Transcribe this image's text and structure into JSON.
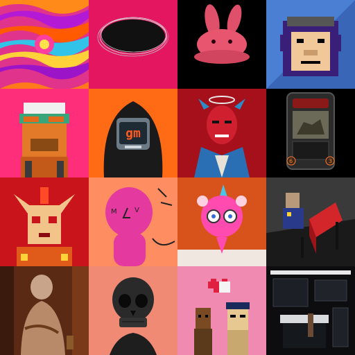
{
  "grid": {
    "tiles": [
      {
        "icon": "psychedelic-swirl-art"
      },
      {
        "icon": "black-ellipse-scribble-art"
      },
      {
        "icon": "pink-bunny-hat-art"
      },
      {
        "icon": "pixel-ape-blue-art"
      },
      {
        "icon": "pixel-ape-goggles-art"
      },
      {
        "icon": "hooded-gm-robot-art"
      },
      {
        "icon": "red-demon-angel-art"
      },
      {
        "icon": "dinosaur-card-art"
      },
      {
        "icon": "pixel-red-demon-art"
      },
      {
        "icon": "pink-doodle-figure-art"
      },
      {
        "icon": "pink-unicorn-figure-art"
      },
      {
        "icon": "pixel-character-red-chair-art"
      },
      {
        "icon": "weathered-sculpture-art"
      },
      {
        "icon": "black-skull-art"
      },
      {
        "icon": "pixel-punks-heart-art"
      },
      {
        "icon": "dark-room-interior-art"
      }
    ],
    "gm_text": "gm",
    "card_left_num": "6",
    "card_right_num": "3"
  }
}
